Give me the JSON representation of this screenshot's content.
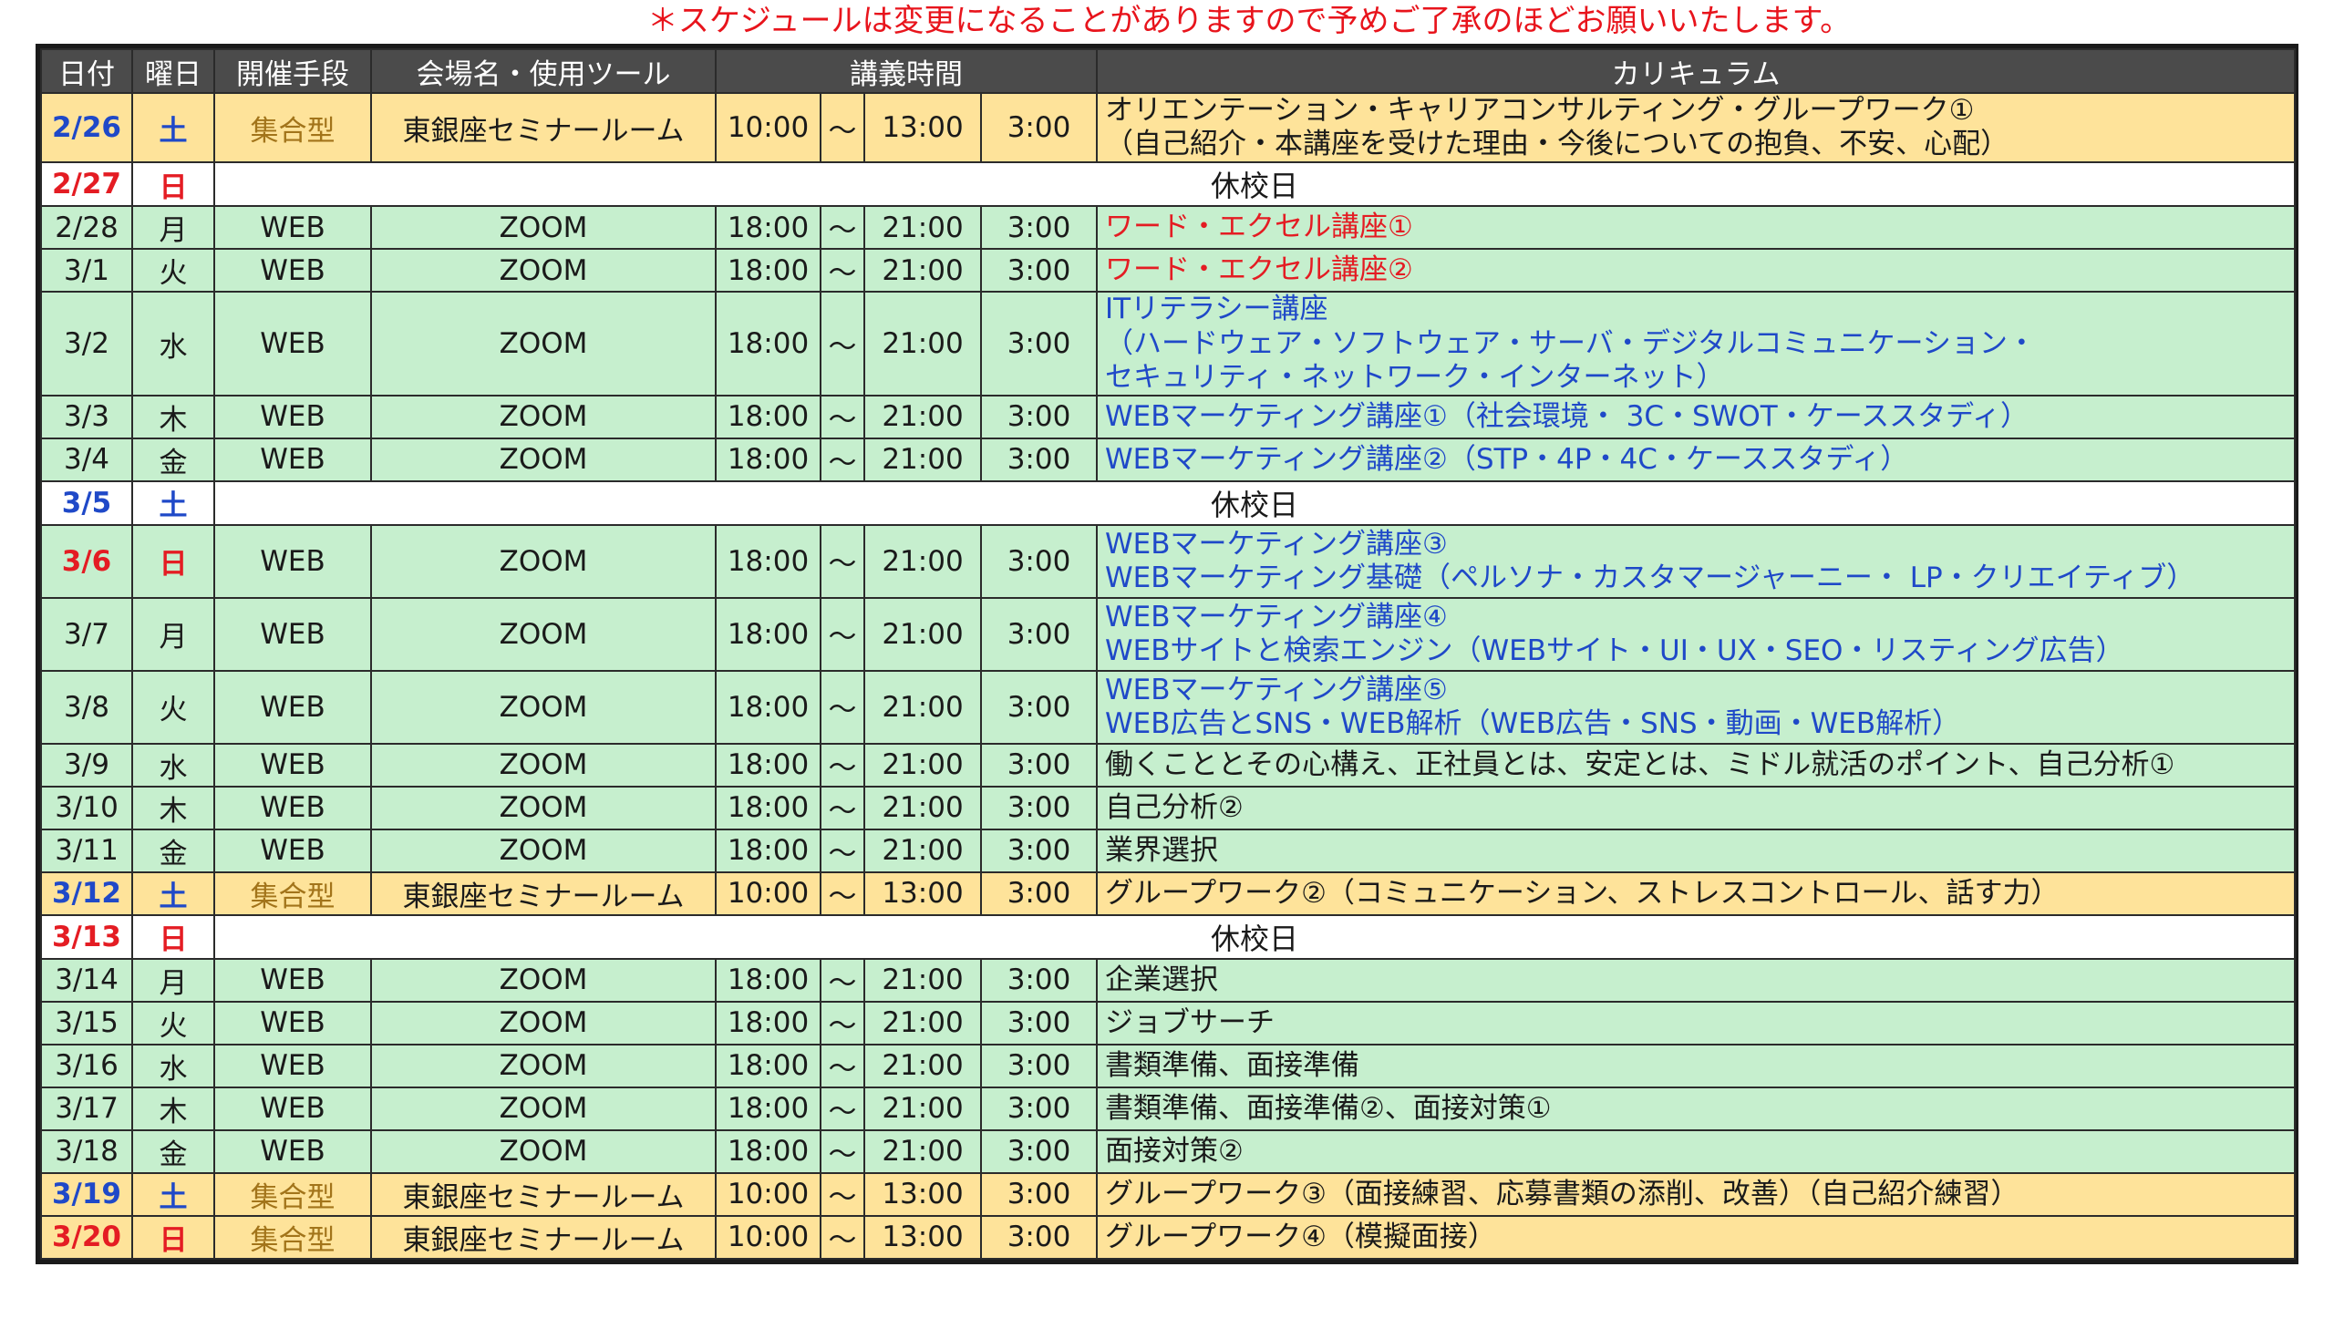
{
  "notice": "＊スケジュールは変更になることがありますので予めご了承のほどお願いいたします。",
  "headers": {
    "date": "日付",
    "weekday": "曜日",
    "method": "開催手段",
    "venue": "会場名・使用ツール",
    "time": "講義時間",
    "curriculum": "カリキュラム"
  },
  "holiday_label": "休校日",
  "rows": [
    {
      "date": "2/26",
      "day": "土",
      "kind": "onsite",
      "method": "集合型",
      "venue": "東銀座セミナールーム",
      "start": "10:00",
      "sep": "～",
      "end": "13:00",
      "dur": "3:00",
      "lines": [
        "オリエンテーション・キャリアコンサルティング・グループワーク①",
        "（自己紹介・本講座を受けた理由・今後についての抱負、不安、心配）"
      ],
      "cur_color": "black",
      "date_color": "blue"
    },
    {
      "date": "2/27",
      "day": "日",
      "kind": "holiday",
      "date_color": "red"
    },
    {
      "date": "2/28",
      "day": "月",
      "kind": "web",
      "method": "WEB",
      "venue": "ZOOM",
      "start": "18:00",
      "sep": "～",
      "end": "21:00",
      "dur": "3:00",
      "lines": [
        "ワード・エクセル講座①"
      ],
      "cur_color": "red",
      "date_color": "black"
    },
    {
      "date": "3/1",
      "day": "火",
      "kind": "web",
      "method": "WEB",
      "venue": "ZOOM",
      "start": "18:00",
      "sep": "～",
      "end": "21:00",
      "dur": "3:00",
      "lines": [
        "ワード・エクセル講座②"
      ],
      "cur_color": "red",
      "date_color": "black"
    },
    {
      "date": "3/2",
      "day": "水",
      "kind": "web",
      "method": "WEB",
      "venue": "ZOOM",
      "start": "18:00",
      "sep": "～",
      "end": "21:00",
      "dur": "3:00",
      "lines": [
        "ITリテラシー講座",
        "（ハードウェア・ソフトウェア・サーバ・デジタルコミュニケーション・",
        "セキュリティ・ネットワーク・インターネット）"
      ],
      "cur_color": "blue",
      "date_color": "black"
    },
    {
      "date": "3/3",
      "day": "木",
      "kind": "web",
      "method": "WEB",
      "venue": "ZOOM",
      "start": "18:00",
      "sep": "～",
      "end": "21:00",
      "dur": "3:00",
      "lines": [
        "WEBマーケティング講座①（社会環境・ 3C・SWOT・ケーススタディ）"
      ],
      "cur_color": "blue",
      "date_color": "black"
    },
    {
      "date": "3/4",
      "day": "金",
      "kind": "web",
      "method": "WEB",
      "venue": "ZOOM",
      "start": "18:00",
      "sep": "～",
      "end": "21:00",
      "dur": "3:00",
      "lines": [
        "WEBマーケティング講座②（STP・4P・4C・ケーススタディ）"
      ],
      "cur_color": "blue",
      "date_color": "black"
    },
    {
      "date": "3/5",
      "day": "土",
      "kind": "holiday",
      "date_color": "blue"
    },
    {
      "date": "3/6",
      "day": "日",
      "kind": "web",
      "method": "WEB",
      "venue": "ZOOM",
      "start": "18:00",
      "sep": "～",
      "end": "21:00",
      "dur": "3:00",
      "lines": [
        "WEBマーケティング講座③",
        "WEBマーケティング基礎（ペルソナ・カスタマージャーニー・ LP・クリエイティブ）"
      ],
      "cur_color": "blue",
      "date_color": "red"
    },
    {
      "date": "3/7",
      "day": "月",
      "kind": "web",
      "method": "WEB",
      "venue": "ZOOM",
      "start": "18:00",
      "sep": "～",
      "end": "21:00",
      "dur": "3:00",
      "lines": [
        "WEBマーケティング講座④",
        "WEBサイトと検索エンジン（WEBサイト・UI・UX・SEO・リスティング広告）"
      ],
      "cur_color": "blue",
      "date_color": "black"
    },
    {
      "date": "3/8",
      "day": "火",
      "kind": "web",
      "method": "WEB",
      "venue": "ZOOM",
      "start": "18:00",
      "sep": "～",
      "end": "21:00",
      "dur": "3:00",
      "lines": [
        "WEBマーケティング講座⑤",
        "WEB広告とSNS・WEB解析（WEB広告・SNS・動画・WEB解析）"
      ],
      "cur_color": "blue",
      "date_color": "black"
    },
    {
      "date": "3/9",
      "day": "水",
      "kind": "web",
      "method": "WEB",
      "venue": "ZOOM",
      "start": "18:00",
      "sep": "～",
      "end": "21:00",
      "dur": "3:00",
      "lines": [
        "働くこととその心構え、正社員とは、安定とは、ミドル就活のポイント、自己分析①"
      ],
      "cur_color": "black",
      "date_color": "black"
    },
    {
      "date": "3/10",
      "day": "木",
      "kind": "web",
      "method": "WEB",
      "venue": "ZOOM",
      "start": "18:00",
      "sep": "～",
      "end": "21:00",
      "dur": "3:00",
      "lines": [
        "自己分析②"
      ],
      "cur_color": "black",
      "date_color": "black"
    },
    {
      "date": "3/11",
      "day": "金",
      "kind": "web",
      "method": "WEB",
      "venue": "ZOOM",
      "start": "18:00",
      "sep": "～",
      "end": "21:00",
      "dur": "3:00",
      "lines": [
        "業界選択"
      ],
      "cur_color": "black",
      "date_color": "black"
    },
    {
      "date": "3/12",
      "day": "土",
      "kind": "onsite",
      "method": "集合型",
      "venue": "東銀座セミナールーム",
      "start": "10:00",
      "sep": "～",
      "end": "13:00",
      "dur": "3:00",
      "lines": [
        "グループワーク②（コミュニケーション、ストレスコントロール、話す力）"
      ],
      "cur_color": "black",
      "date_color": "blue"
    },
    {
      "date": "3/13",
      "day": "日",
      "kind": "holiday",
      "date_color": "red"
    },
    {
      "date": "3/14",
      "day": "月",
      "kind": "web",
      "method": "WEB",
      "venue": "ZOOM",
      "start": "18:00",
      "sep": "～",
      "end": "21:00",
      "dur": "3:00",
      "lines": [
        "企業選択"
      ],
      "cur_color": "black",
      "date_color": "black"
    },
    {
      "date": "3/15",
      "day": "火",
      "kind": "web",
      "method": "WEB",
      "venue": "ZOOM",
      "start": "18:00",
      "sep": "～",
      "end": "21:00",
      "dur": "3:00",
      "lines": [
        "ジョブサーチ"
      ],
      "cur_color": "black",
      "date_color": "black"
    },
    {
      "date": "3/16",
      "day": "水",
      "kind": "web",
      "method": "WEB",
      "venue": "ZOOM",
      "start": "18:00",
      "sep": "～",
      "end": "21:00",
      "dur": "3:00",
      "lines": [
        "書類準備、面接準備"
      ],
      "cur_color": "black",
      "date_color": "black"
    },
    {
      "date": "3/17",
      "day": "木",
      "kind": "web",
      "method": "WEB",
      "venue": "ZOOM",
      "start": "18:00",
      "sep": "～",
      "end": "21:00",
      "dur": "3:00",
      "lines": [
        "書類準備、面接準備②、面接対策①"
      ],
      "cur_color": "black",
      "date_color": "black"
    },
    {
      "date": "3/18",
      "day": "金",
      "kind": "web",
      "method": "WEB",
      "venue": "ZOOM",
      "start": "18:00",
      "sep": "～",
      "end": "21:00",
      "dur": "3:00",
      "lines": [
        "面接対策②"
      ],
      "cur_color": "black",
      "date_color": "black"
    },
    {
      "date": "3/19",
      "day": "土",
      "kind": "onsite",
      "method": "集合型",
      "venue": "東銀座セミナールーム",
      "start": "10:00",
      "sep": "～",
      "end": "13:00",
      "dur": "3:00",
      "lines": [
        "グループワーク③（面接練習、応募書類の添削、改善）（自己紹介練習）"
      ],
      "cur_color": "black",
      "date_color": "blue"
    },
    {
      "date": "3/20",
      "day": "日",
      "kind": "onsite",
      "method": "集合型",
      "venue": "東銀座セミナールーム",
      "start": "10:00",
      "sep": "～",
      "end": "13:00",
      "dur": "3:00",
      "lines": [
        "グループワーク④（模擬面接）"
      ],
      "cur_color": "black",
      "date_color": "red"
    }
  ]
}
